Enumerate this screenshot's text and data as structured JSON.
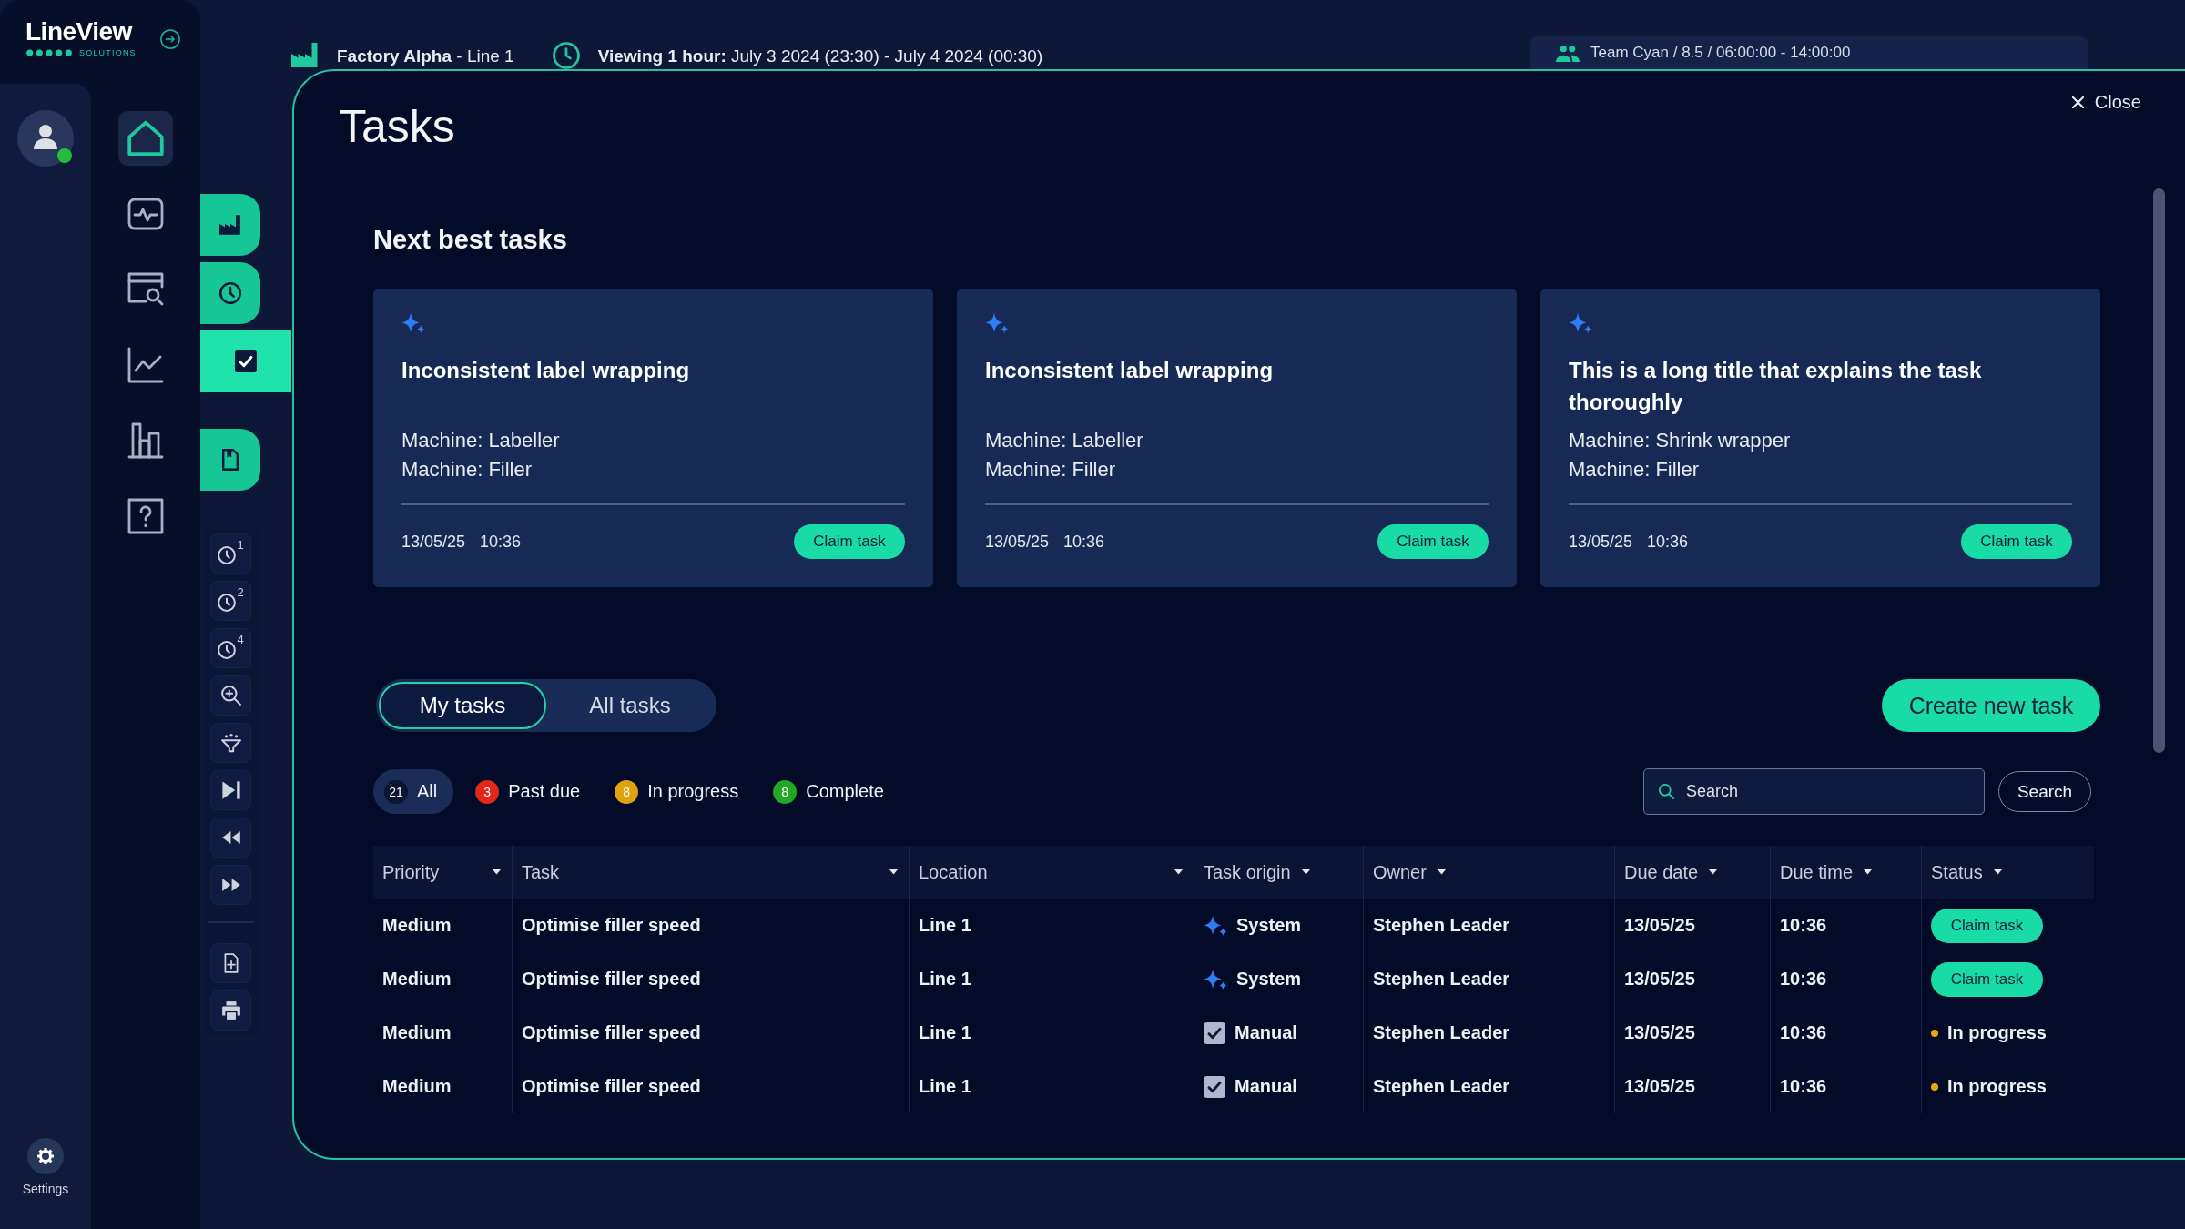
{
  "sidebar": {
    "logo": {
      "wordmark": "LineView",
      "tagline": "SOLUTIONS"
    },
    "user": {
      "online": true
    },
    "nav_items": [
      {
        "selected": true
      },
      {
        "selected": false
      },
      {
        "selected": false
      },
      {
        "selected": false
      },
      {
        "selected": false
      },
      {
        "selected": false
      }
    ],
    "settings_label": "Settings"
  },
  "rail": {
    "tabs": [
      {
        "selected": false
      },
      {
        "selected": false
      },
      {
        "selected": true
      },
      {
        "selected": false
      }
    ],
    "clock_tools": [
      {
        "label": "1"
      },
      {
        "label": "2"
      },
      {
        "label": "4"
      }
    ]
  },
  "context_bar": {
    "location": "**Factory Alpha** - Line 1",
    "viewing": "**Viewing 1 hour:** July 3 2024 (23:30) - July 4 2024 (00:30)",
    "team": "Team Cyan / 8.5 / 06:00:00 - 14:00:00"
  },
  "dialog": {
    "title": "Tasks",
    "close": "Close",
    "next_best": {
      "heading": "Next best tasks",
      "cards": [
        {
          "title": "Inconsistent label wrapping",
          "machines": [
            "Machine: Labeller",
            "Machine: Filler"
          ],
          "date": "13/05/25",
          "time": "10:36",
          "action": "Claim task"
        },
        {
          "title": "Inconsistent label wrapping",
          "machines": [
            "Machine: Labeller",
            "Machine: Filler"
          ],
          "date": "13/05/25",
          "time": "10:36",
          "action": "Claim task"
        },
        {
          "title": "This is a long title that explains the task thoroughly",
          "machines": [
            "Machine: Shrink wrapper",
            "Machine: Filler"
          ],
          "date": "13/05/25",
          "time": "10:36",
          "action": "Claim task"
        }
      ]
    },
    "tabs": [
      {
        "label": "My tasks",
        "selected": true
      },
      {
        "label": "All tasks",
        "selected": false
      }
    ],
    "create_button": "Create new task",
    "filters": [
      {
        "count": "21",
        "label": "All",
        "color": "#0a1433",
        "selected": true
      },
      {
        "count": "3",
        "label": "Past due",
        "color": "#e5261b",
        "selected": false
      },
      {
        "count": "8",
        "label": "In progress",
        "color": "#e0a20f",
        "selected": false
      },
      {
        "count": "8",
        "label": "Complete",
        "color": "#22a822",
        "selected": false
      }
    ],
    "search": {
      "placeholder": "Search",
      "button": "Search"
    },
    "table": {
      "columns": [
        {
          "label": "Priority",
          "kind": "dropdown"
        },
        {
          "label": "Task",
          "kind": "dropdown"
        },
        {
          "label": "Location",
          "kind": "dropdown"
        },
        {
          "label": "Task origin",
          "kind": "sort"
        },
        {
          "label": "Owner",
          "kind": "sort"
        },
        {
          "label": "Due date",
          "kind": "sort"
        },
        {
          "label": "Due time",
          "kind": "sort"
        },
        {
          "label": "Status",
          "kind": "sort"
        }
      ],
      "rows": [
        {
          "priority": "Medium",
          "task": "Optimise filler speed",
          "location": "Line 1",
          "origin": {
            "kind": "system",
            "label": "System"
          },
          "owner": "Stephen Leader",
          "due_date": "13/05/25",
          "due_time": "10:36",
          "status": {
            "kind": "claim",
            "label": "Claim task"
          }
        },
        {
          "priority": "Medium",
          "task": "Optimise filler speed",
          "location": "Line 1",
          "origin": {
            "kind": "system",
            "label": "System"
          },
          "owner": "Stephen Leader",
          "due_date": "13/05/25",
          "due_time": "10:36",
          "status": {
            "kind": "claim",
            "label": "Claim task"
          }
        },
        {
          "priority": "Medium",
          "task": "Optimise filler speed",
          "location": "Line 1",
          "origin": {
            "kind": "manual",
            "label": "Manual"
          },
          "owner": "Stephen Leader",
          "due_date": "13/05/25",
          "due_time": "10:36",
          "status": {
            "kind": "in_progress",
            "label": "In progress"
          }
        },
        {
          "priority": "Medium",
          "task": "Optimise filler speed",
          "location": "Line 1",
          "origin": {
            "kind": "manual",
            "label": "Manual"
          },
          "owner": "Stephen Leader",
          "due_date": "13/05/25",
          "due_time": "10:36",
          "status": {
            "kind": "in_progress",
            "label": "In progress"
          }
        }
      ]
    }
  }
}
